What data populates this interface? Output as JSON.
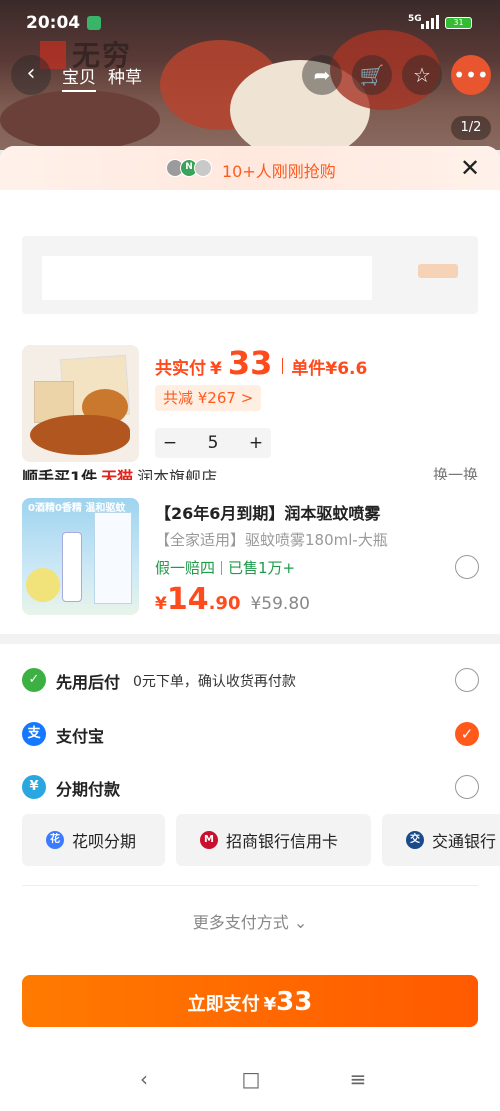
{
  "status_bar": {
    "time": "20:04",
    "network": "5G",
    "battery": "31"
  },
  "nav": {
    "tabs": [
      "宝贝",
      "种草"
    ],
    "image_counter": "1/2"
  },
  "brand_watermark": "无穷",
  "sheet": {
    "recent_buyers": "10+人刚刚抢购",
    "product": {
      "price_prefix": "共实付",
      "currency": "¥",
      "total": "33",
      "unit_price": "单件¥6.6",
      "discount": "共减 ¥267 >",
      "quantity": "5",
      "qty_minus": "−",
      "qty_plus": "+"
    },
    "addon_section": {
      "title_prefix": "顺手买1件",
      "tmall": "天猫",
      "store": "润本旗舰店",
      "swap": "换一换"
    },
    "addon_product": {
      "title": "【26年6月到期】润本驱蚊喷雾",
      "spec": "【全家适用】驱蚊喷雾180ml-大瓶",
      "tag1": "假一赔四",
      "tag2": "已售1万+",
      "currency": "¥",
      "price_int": "14",
      "price_dec": ".90",
      "original_price": "¥59.80",
      "image_badge": "0酒精0香精 温和驱蚊"
    },
    "payment": [
      {
        "label": "先用后付",
        "desc": "0元下单，确认收货再付款",
        "color": "#3cb043",
        "selected": false
      },
      {
        "label": "支付宝",
        "desc": "",
        "color": "#1677ff",
        "selected": true
      },
      {
        "label": "分期付款",
        "desc": "",
        "color": "#2aa6e0",
        "selected": false
      }
    ],
    "installments": [
      {
        "label": "花呗分期",
        "color": "#3a7bff"
      },
      {
        "label": "招商银行信用卡",
        "color": "#c8102e"
      },
      {
        "label": "交通银行",
        "color": "#1a4a8a"
      }
    ],
    "more_payment": "更多支付方式",
    "pay_button": {
      "label": "立即支付",
      "currency": "¥",
      "amount": "33"
    }
  }
}
